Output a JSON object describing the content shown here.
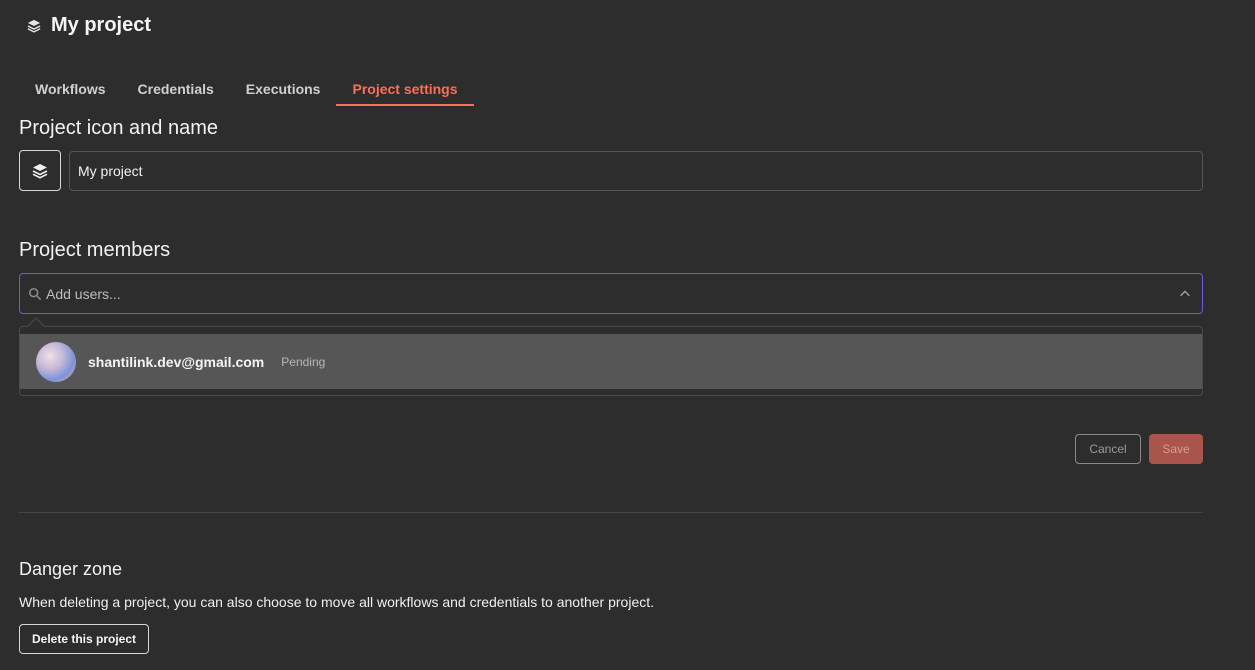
{
  "header": {
    "title": "My project",
    "icon": "layers-icon"
  },
  "tabs": [
    {
      "label": "Workflows",
      "active": false
    },
    {
      "label": "Credentials",
      "active": false
    },
    {
      "label": "Executions",
      "active": false
    },
    {
      "label": "Project settings",
      "active": true
    }
  ],
  "project": {
    "section_title": "Project icon and name",
    "name_value": "My project",
    "icon": "layers-icon"
  },
  "members": {
    "section_title": "Project members",
    "search_placeholder": "Add users...",
    "list": [
      {
        "email": "shantilink.dev@gmail.com",
        "status": "Pending"
      }
    ]
  },
  "actions": {
    "cancel_label": "Cancel",
    "save_label": "Save"
  },
  "danger": {
    "title": "Danger zone",
    "description": "When deleting a project, you can also choose to move all workflows and credentials to another project.",
    "delete_label": "Delete this project"
  },
  "colors": {
    "background": "#2c2d2c",
    "accent": "#ff6d5a",
    "focus_border": "#6a5fd6",
    "save_button": "#a9554b",
    "selected_row": "#565656"
  }
}
